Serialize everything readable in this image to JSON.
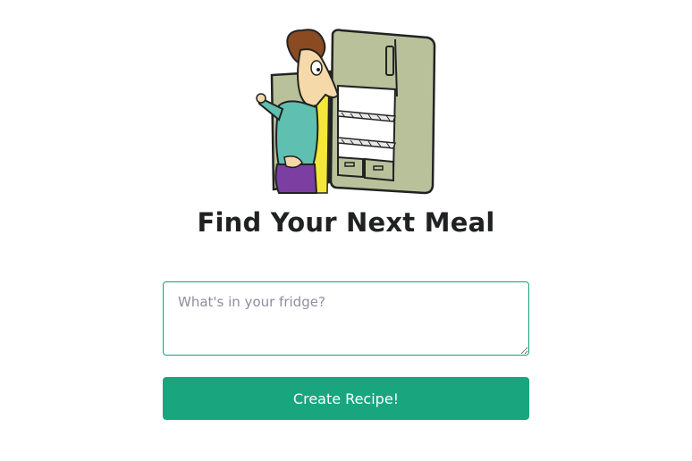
{
  "header": {
    "title": "Find Your Next Meal",
    "illustration": "man-looking-in-fridge"
  },
  "form": {
    "ingredients_placeholder": "What's in your fridge?",
    "ingredients_value": "",
    "submit_label": "Create Recipe!"
  },
  "colors": {
    "accent": "#19a67f",
    "title_text": "#202123",
    "placeholder_text": "#8e8ea0",
    "fridge_body": "#b9c19b"
  }
}
